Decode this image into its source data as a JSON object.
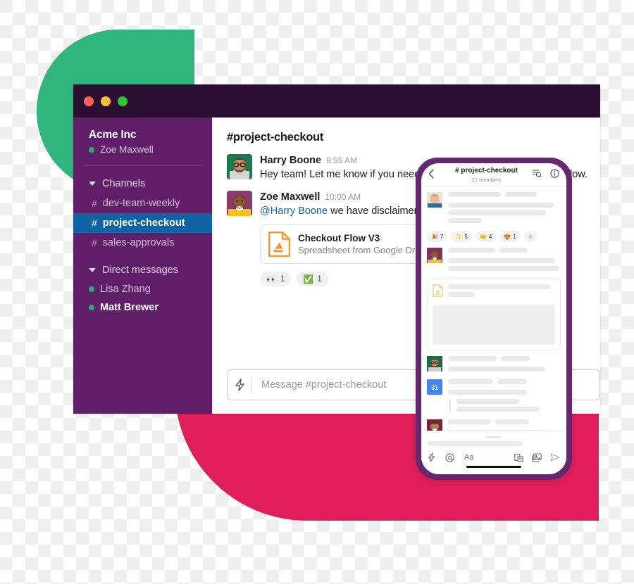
{
  "window": {
    "traffic_lights": [
      "close",
      "minimize",
      "maximize"
    ]
  },
  "sidebar": {
    "team_name": "Acme Inc",
    "current_user": "Zoe Maxwell",
    "sections": [
      {
        "label": "Channels"
      },
      {
        "label": "Direct messages"
      }
    ],
    "channels": [
      {
        "hash": "#",
        "name": "dev-team-weekly",
        "active": false
      },
      {
        "hash": "#",
        "name": "project-checkout",
        "active": true
      },
      {
        "hash": "#",
        "name": "sales-approvals",
        "active": false
      }
    ],
    "direct_messages": [
      {
        "name": "Lisa Zhang",
        "unread": false
      },
      {
        "name": "Matt Brewer",
        "unread": true
      }
    ]
  },
  "main": {
    "channel_title": "#project-checkout",
    "messages": [
      {
        "author": "Harry Boone",
        "time": "9:55 AM",
        "text": "Hey team! Let me know if you need legal guidance for the checkout flow."
      },
      {
        "author": "Zoe Maxwell",
        "time": "10:00 AM",
        "mention": "@Harry Boone",
        "text": " we have disclaimers we'd like you to review.",
        "attachment": {
          "title": "Checkout Flow V3",
          "meta": "Spreadsheet from Google Drive",
          "icon": "google-drive-icon"
        },
        "reactions": [
          {
            "emoji": "👀",
            "name": "eyes-emoji",
            "count": "1"
          },
          {
            "emoji": "✅",
            "name": "white-check-mark-emoji",
            "count": "1"
          }
        ]
      }
    ],
    "composer": {
      "placeholder": "Message #project-checkout",
      "lightning_icon": "lightning-bolt-icon"
    }
  },
  "phone": {
    "header": {
      "back_icon": "chevron-left-icon",
      "title": "# project-checkout",
      "members": "21 members",
      "search_icon": "search-list-icon",
      "info_icon": "info-circle-icon"
    },
    "reactions": [
      {
        "emoji": "🎉",
        "name": "tada-emoji",
        "count": "7"
      },
      {
        "emoji": "✨",
        "name": "sparkles-emoji",
        "count": "5"
      },
      {
        "emoji": "🤜",
        "name": "fist-emoji",
        "count": "4"
      },
      {
        "emoji": "😍",
        "name": "heart-eyes-emoji",
        "count": "1"
      },
      {
        "emoji": "☺",
        "name": "add-reaction-icon",
        "count": ""
      }
    ],
    "footer_tools": {
      "lightning_icon": "lightning-bolt-icon",
      "mention_icon": "at-mention-icon",
      "format_icon": "Aa",
      "attach_icon": "attachment-icon",
      "photo_icon": "photo-icon",
      "send_icon": "send-icon"
    }
  },
  "colors": {
    "slack_aubergine": "#611f69",
    "slack_blue": "#1164a3",
    "slack_green": "#2eb67d",
    "slack_pink": "#e01e5a",
    "titlebar": "#2b0f31",
    "phone_bezel": "#65276d"
  }
}
